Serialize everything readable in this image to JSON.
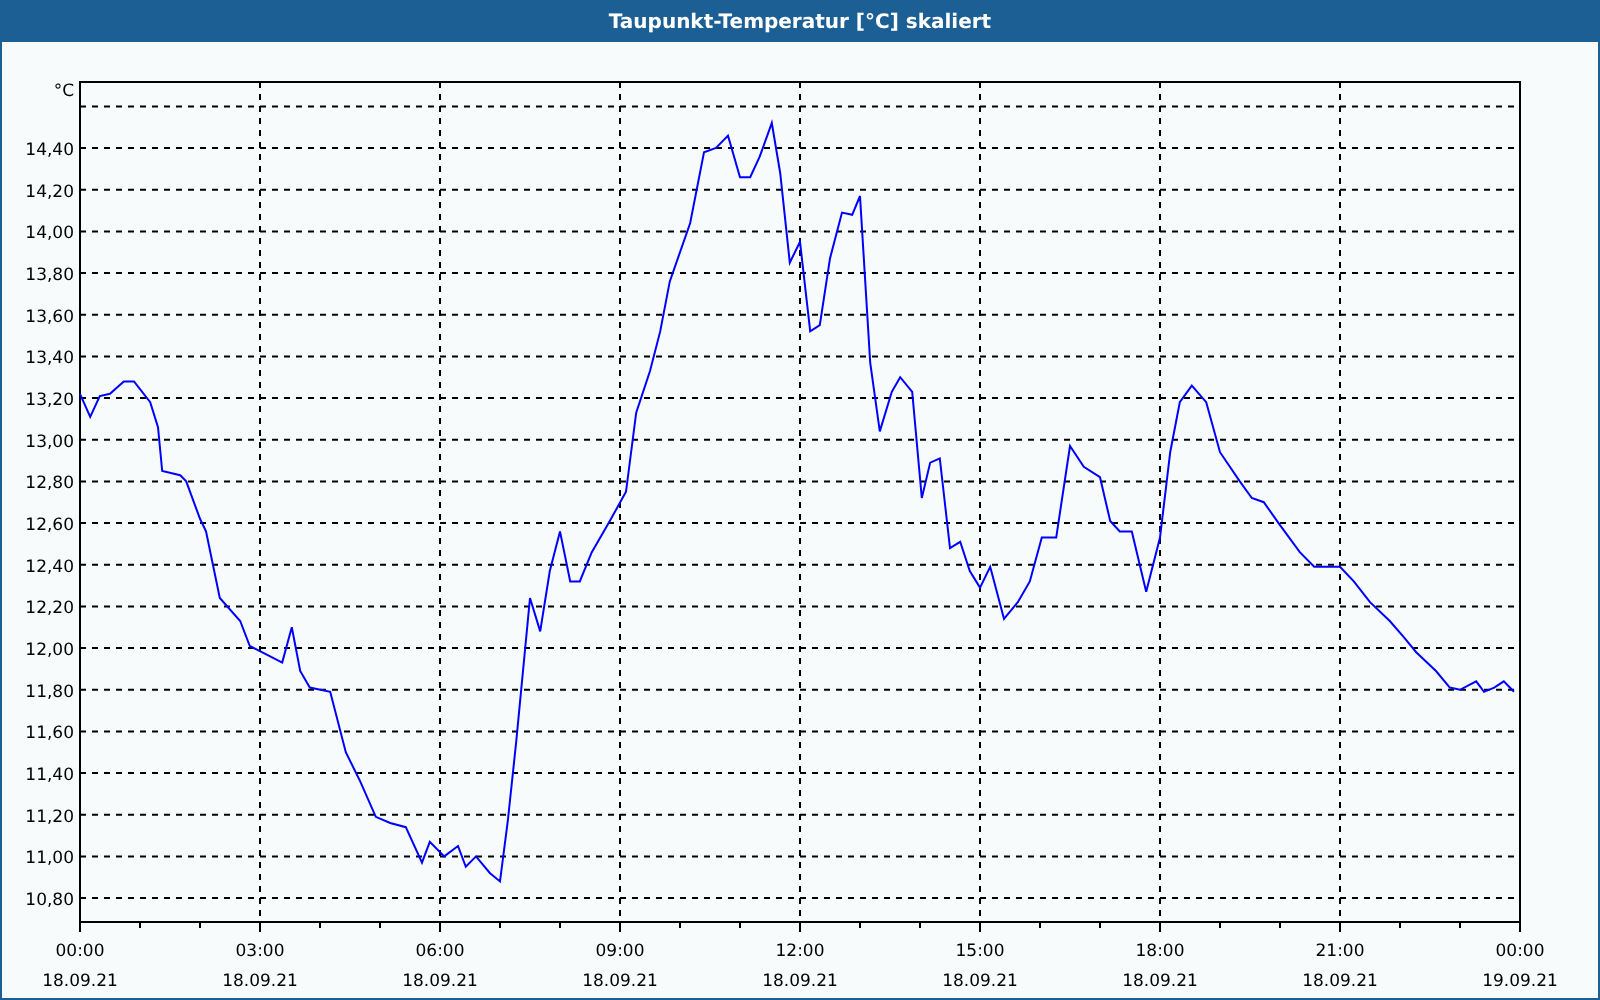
{
  "window": {
    "title": "Taupunkt-Temperatur [°C] skaliert"
  },
  "chart": {
    "chart_data": {
      "type": "line",
      "ylabel": "°C",
      "x": [
        0,
        0.17,
        0.33,
        0.5,
        0.73,
        0.9,
        1.17,
        1.3,
        1.37,
        1.67,
        1.77,
        2,
        2.1,
        2.33,
        2.67,
        2.83,
        3.17,
        3.37,
        3.53,
        3.67,
        3.83,
        4.17,
        4.43,
        4.67,
        4.93,
        5.17,
        5.43,
        5.7,
        5.83,
        6.07,
        6.3,
        6.43,
        6.6,
        6.83,
        7,
        7.13,
        7.27,
        7.5,
        7.67,
        7.83,
        8,
        8.17,
        8.33,
        8.53,
        8.83,
        9.1,
        9.27,
        9.5,
        9.67,
        9.83,
        10.17,
        10.4,
        10.6,
        10.8,
        11,
        11.17,
        11.33,
        11.53,
        11.67,
        11.83,
        12,
        12.17,
        12.33,
        12.5,
        12.7,
        12.87,
        13,
        13.17,
        13.33,
        13.53,
        13.67,
        13.87,
        14.03,
        14.17,
        14.33,
        14.5,
        14.67,
        14.83,
        15,
        15.17,
        15.4,
        15.63,
        15.83,
        16.03,
        16.27,
        16.5,
        16.73,
        17,
        17.17,
        17.33,
        17.53,
        17.77,
        18,
        18.17,
        18.33,
        18.53,
        18.77,
        19,
        19.33,
        19.53,
        19.73,
        20,
        20.33,
        20.57,
        20.73,
        21,
        21.23,
        21.5,
        21.83,
        22.07,
        22.27,
        22.6,
        22.83,
        23,
        23.27,
        23.4,
        23.57,
        23.73,
        23.9
      ],
      "series": [
        {
          "color": "#0000ff",
          "values": [
            13.22,
            13.11,
            13.21,
            13.22,
            13.28,
            13.28,
            13.18,
            13.06,
            12.85,
            12.83,
            12.8,
            12.62,
            12.56,
            12.24,
            12.13,
            12.01,
            11.96,
            11.93,
            12.1,
            11.89,
            11.81,
            11.79,
            11.5,
            11.36,
            11.19,
            11.16,
            11.14,
            10.97,
            11.07,
            11,
            11.05,
            10.95,
            11,
            10.92,
            10.88,
            11.17,
            11.55,
            12.24,
            12.08,
            12.37,
            12.56,
            12.32,
            12.32,
            12.46,
            12.61,
            12.75,
            13.13,
            13.33,
            13.52,
            13.76,
            14.04,
            14.38,
            14.4,
            14.46,
            14.26,
            14.26,
            14.36,
            14.52,
            14.28,
            13.85,
            13.95,
            13.52,
            13.55,
            13.87,
            14.09,
            14.08,
            14.17,
            13.37,
            13.04,
            13.23,
            13.3,
            13.23,
            12.72,
            12.89,
            12.91,
            12.48,
            12.51,
            12.37,
            12.29,
            12.39,
            12.14,
            12.22,
            12.32,
            12.53,
            12.53,
            12.97,
            12.87,
            12.82,
            12.61,
            12.56,
            12.56,
            12.27,
            12.53,
            12.94,
            13.18,
            13.26,
            13.18,
            12.94,
            12.8,
            12.72,
            12.7,
            12.59,
            12.46,
            12.39,
            12.39,
            12.39,
            12.32,
            12.22,
            12.13,
            12.05,
            11.98,
            11.89,
            11.81,
            11.8,
            11.84,
            11.79,
            11.81,
            11.84,
            11.79
          ]
        }
      ],
      "grid": true,
      "xlim": [
        0,
        24
      ],
      "ylim": [
        10.685,
        14.717
      ],
      "xticks": [
        {
          "value": 0,
          "label": "00:00"
        },
        {
          "value": 3,
          "label": "03:00"
        },
        {
          "value": 6,
          "label": "06:00"
        },
        {
          "value": 9,
          "label": "09:00"
        },
        {
          "value": 12,
          "label": "12:00"
        },
        {
          "value": 15,
          "label": "15:00"
        },
        {
          "value": 18,
          "label": "18:00"
        },
        {
          "value": 21,
          "label": "21:00"
        },
        {
          "value": 24,
          "label": "00:00"
        }
      ],
      "yticks": [
        {
          "value": 10.8,
          "label": "10,80"
        },
        {
          "value": 11,
          "label": "11,00"
        },
        {
          "value": 11.2,
          "label": "11,20"
        },
        {
          "value": 11.4,
          "label": "11,40"
        },
        {
          "value": 11.6,
          "label": "11,60"
        },
        {
          "value": 11.8,
          "label": "11,80"
        },
        {
          "value": 12,
          "label": "12,00"
        },
        {
          "value": 12.2,
          "label": "12,20"
        },
        {
          "value": 12.4,
          "label": "12,40"
        },
        {
          "value": 12.6,
          "label": "12,60"
        },
        {
          "value": 12.8,
          "label": "12,80"
        },
        {
          "value": 13,
          "label": "13,00"
        },
        {
          "value": 13.2,
          "label": "13,20"
        },
        {
          "value": 13.4,
          "label": "13,40"
        },
        {
          "value": 13.6,
          "label": "13,60"
        },
        {
          "value": 13.8,
          "label": "13,80"
        },
        {
          "value": 14,
          "label": "14,00"
        },
        {
          "value": 14.2,
          "label": "14,20"
        },
        {
          "value": 14.4,
          "label": "14,40"
        }
      ]
    },
    "date_labels": [
      "18.09.21",
      "18.09.21",
      "18.09.21",
      "18.09.21",
      "18.09.21",
      "18.09.21",
      "18.09.21",
      "18.09.21",
      "19.09.21"
    ]
  }
}
